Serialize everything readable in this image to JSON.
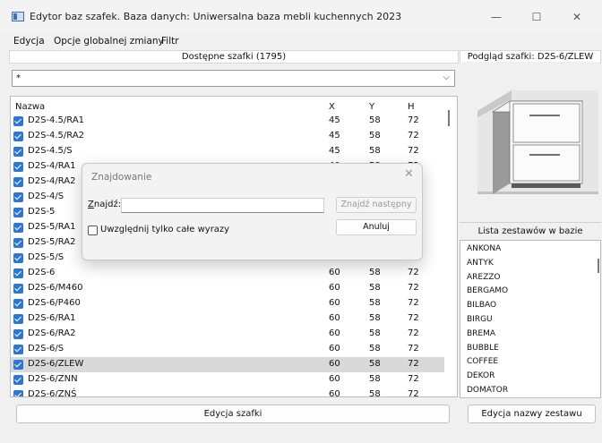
{
  "window": {
    "title": "Edytor baz szafek. Baza danych: Uniwersalna baza mebli kuchennych 2023",
    "minimize_icon": "—",
    "maximize_icon": "☐",
    "close_icon": "✕"
  },
  "menu": [
    "Edycja",
    "Opcje globalnej zmiany",
    "Filtr"
  ],
  "left_panel": {
    "header": "Dostępne szafki (1795)",
    "filter_value": "*",
    "columns": [
      "Nazwa",
      "X",
      "Y",
      "H"
    ],
    "rows": [
      {
        "name": "D2S-4.5/RA1",
        "x": "45",
        "y": "58",
        "h": "72"
      },
      {
        "name": "D2S-4.5/RA2",
        "x": "45",
        "y": "58",
        "h": "72"
      },
      {
        "name": "D2S-4.5/S",
        "x": "45",
        "y": "58",
        "h": "72"
      },
      {
        "name": "D2S-4/RA1",
        "x": "40",
        "y": "58",
        "h": "72"
      },
      {
        "name": "D2S-4/RA2",
        "x": "40",
        "y": "58",
        "h": "72"
      },
      {
        "name": "D2S-4/S",
        "x": "40",
        "y": "58",
        "h": "72"
      },
      {
        "name": "D2S-5",
        "x": "50",
        "y": "58",
        "h": "72"
      },
      {
        "name": "D2S-5/RA1",
        "x": "50",
        "y": "58",
        "h": "72"
      },
      {
        "name": "D2S-5/RA2",
        "x": "50",
        "y": "58",
        "h": "72"
      },
      {
        "name": "D2S-5/S",
        "x": "50",
        "y": "58",
        "h": "72"
      },
      {
        "name": "D2S-6",
        "x": "60",
        "y": "58",
        "h": "72"
      },
      {
        "name": "D2S-6/M460",
        "x": "60",
        "y": "58",
        "h": "72"
      },
      {
        "name": "D2S-6/P460",
        "x": "60",
        "y": "58",
        "h": "72"
      },
      {
        "name": "D2S-6/RA1",
        "x": "60",
        "y": "58",
        "h": "72"
      },
      {
        "name": "D2S-6/RA2",
        "x": "60",
        "y": "58",
        "h": "72"
      },
      {
        "name": "D2S-6/S",
        "x": "60",
        "y": "58",
        "h": "72"
      },
      {
        "name": "D2S-6/ZLEW",
        "x": "60",
        "y": "58",
        "h": "72"
      },
      {
        "name": "D2S-6/ZNN",
        "x": "60",
        "y": "58",
        "h": "72"
      },
      {
        "name": "D2S-6/ZNŚ",
        "x": "60",
        "y": "58",
        "h": "72"
      }
    ],
    "selected_row": 16,
    "edit_button": "Edycja szafki"
  },
  "right_panel": {
    "preview_header": "Podgląd szafki: D2S-6/ZLEW",
    "sets_header": "Lista zestawów w bazie",
    "sets": [
      "ANKONA",
      "ANTYK",
      "AREZZO",
      "BERGAMO",
      "BILBAO",
      "BIRGU",
      "BREMA",
      "BUBBLE",
      "COFFEE",
      "DEKOR",
      "DOMATOR"
    ],
    "rename_button": "Edycja nazwy zestawu"
  },
  "find_dialog": {
    "title": "Znajdowanie",
    "find_label": "Znajdź:",
    "find_value": "",
    "find_next": "Znajdź następny",
    "cancel": "Anuluj",
    "whole_words": "Uwzględnij tylko całe wyrazy",
    "whole_words_checked": false
  }
}
